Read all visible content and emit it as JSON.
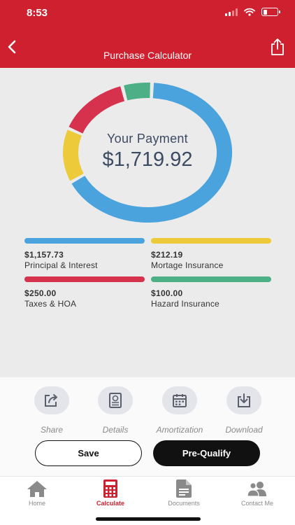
{
  "status_bar": {
    "time": "8:53"
  },
  "header": {
    "title": "Purchase Calculator"
  },
  "summary": {
    "caption": "Your Payment",
    "amount": "$1,719.92"
  },
  "chart_data": {
    "type": "pie",
    "labels": [
      "Principal & Interest",
      "Mortage Insurance",
      "Taxes & HOA",
      "Hazard Insurance"
    ],
    "values": [
      1157.73,
      212.19,
      250.0,
      100.0
    ],
    "colors": [
      "#4aa3dd",
      "#ecca3a",
      "#d6324d",
      "#4caf86"
    ]
  },
  "breakdown": [
    {
      "value": "$1,157.73",
      "label": "Principal & Interest",
      "color": "#4aa3dd"
    },
    {
      "value": "$212.19",
      "label": "Mortage Insurance",
      "color": "#ecca3a"
    },
    {
      "value": "$250.00",
      "label": "Taxes & HOA",
      "color": "#d6324d"
    },
    {
      "value": "$100.00",
      "label": "Hazard Insurance",
      "color": "#4caf86"
    }
  ],
  "actions": [
    {
      "label": "Share",
      "icon": "share-icon"
    },
    {
      "label": "Details",
      "icon": "details-icon"
    },
    {
      "label": "Amortization",
      "icon": "calendar-icon"
    },
    {
      "label": "Download",
      "icon": "download-icon"
    }
  ],
  "buttons": {
    "save": "Save",
    "prequalify": "Pre-Qualify"
  },
  "tabs": [
    {
      "label": "Home",
      "icon": "home-icon",
      "active": false
    },
    {
      "label": "Calculate",
      "icon": "calculator-icon",
      "active": true
    },
    {
      "label": "Documents",
      "icon": "document-icon",
      "active": false
    },
    {
      "label": "Contact Me",
      "icon": "contacts-icon",
      "active": false
    }
  ],
  "colors": {
    "brand": "#cf202f",
    "donut_text": "#3d4a63",
    "tab_inactive": "#8a8a8a"
  }
}
